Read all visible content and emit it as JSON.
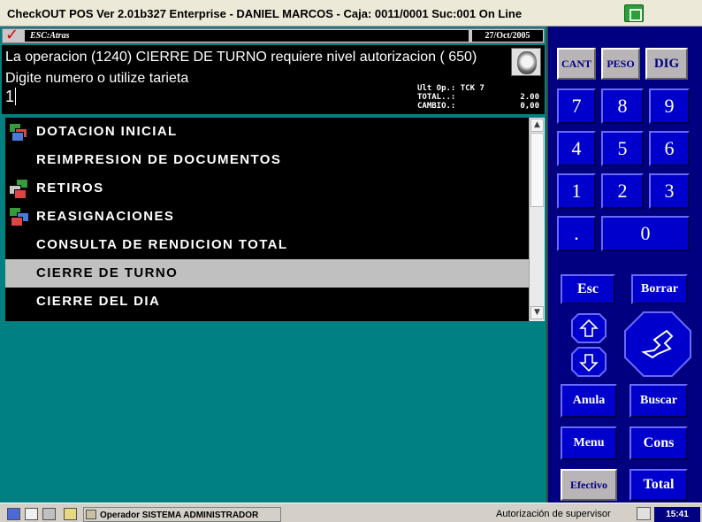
{
  "window": {
    "title": "CheckOUT POS Ver 2.01b327 Enterprise - DANIEL MARCOS - Caja: 0011/0001 Suc:001  On Line",
    "title_icon": "pos-app-icon"
  },
  "statusline": {
    "esc_hint": "ESC:Atras",
    "date": "27/Oct/2005"
  },
  "message": {
    "line1": "La operacion (1240) CIERRE DE TURNO requiere nivel autorizacion ( 650)",
    "line2": "Digite numero  o utilize tarieta",
    "input_value": "1"
  },
  "totals": {
    "rows": [
      {
        "label": "Ult Op.: TCK 7",
        "value": ""
      },
      {
        "label": "TOTAL..:",
        "value": "2.00"
      },
      {
        "label": "CAMBIO.:",
        "value": "0,00"
      }
    ]
  },
  "menu": {
    "items": [
      {
        "label": "DOTACION INICIAL",
        "icon": "money-stack-icon",
        "selected": false
      },
      {
        "label": "REIMPRESION DE DOCUMENTOS",
        "icon": "",
        "selected": false
      },
      {
        "label": "RETIROS",
        "icon": "cash-withdraw-icon",
        "selected": false
      },
      {
        "label": "REASIGNACIONES",
        "icon": "reassign-money-icon",
        "selected": false
      },
      {
        "label": "CONSULTA DE RENDICION TOTAL",
        "icon": "",
        "selected": false
      },
      {
        "label": "CIERRE DE TURNO",
        "icon": "",
        "selected": true
      },
      {
        "label": "CIERRE DEL DIA",
        "icon": "",
        "selected": false
      }
    ]
  },
  "keypad": {
    "cant": "CANT",
    "peso": "PESO",
    "dig": "DIG",
    "digits": [
      "7",
      "8",
      "9",
      "4",
      "5",
      "6",
      "1",
      "2",
      "3"
    ],
    "dot": ".",
    "zero": "0",
    "esc": "Esc",
    "borrar": "Borrar",
    "anula": "Anula",
    "buscar": "Buscar",
    "menu": "Menu",
    "cons": "Cons",
    "efectivo": "Efectivo",
    "total": "Total"
  },
  "bottombar": {
    "operator": "Operador  SISTEMA ADMINISTRADOR",
    "auth_status": "Autorización de supervisor",
    "time": "15:41"
  },
  "colors": {
    "background": "#008080",
    "keypad_bg": "#000080",
    "key_blue": "#0000cc",
    "selected_row": "#c0c0c0"
  }
}
